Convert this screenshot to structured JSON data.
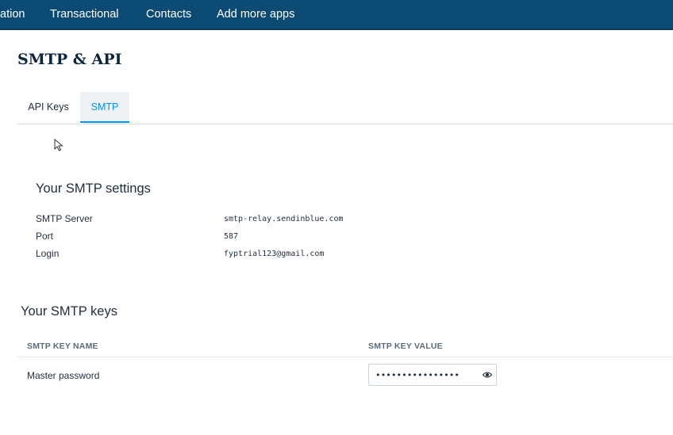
{
  "nav": {
    "items": [
      {
        "label": "ation"
      },
      {
        "label": "Transactional"
      },
      {
        "label": "Contacts"
      },
      {
        "label": "Add more apps"
      }
    ]
  },
  "page": {
    "title": "SMTP & API"
  },
  "tabs": [
    {
      "label": "API Keys",
      "active": false
    },
    {
      "label": "SMTP",
      "active": true
    }
  ],
  "smtp_settings": {
    "title": "Your SMTP settings",
    "rows": [
      {
        "label": "SMTP Server",
        "value": "smtp-relay.sendinblue.com"
      },
      {
        "label": "Port",
        "value": "587"
      },
      {
        "label": "Login",
        "value": "fyptrial123@gmail.com"
      }
    ]
  },
  "smtp_keys": {
    "title": "Your SMTP keys",
    "columns": {
      "name": "SMTP KEY NAME",
      "value": "SMTP KEY VALUE"
    },
    "rows": [
      {
        "name": "Master password",
        "value": "••••••••••••••••",
        "reveal_icon": "eye-icon"
      }
    ]
  },
  "colors": {
    "nav_bg": "#0b4a73",
    "accent": "#0092ff",
    "title": "#0b2540"
  }
}
